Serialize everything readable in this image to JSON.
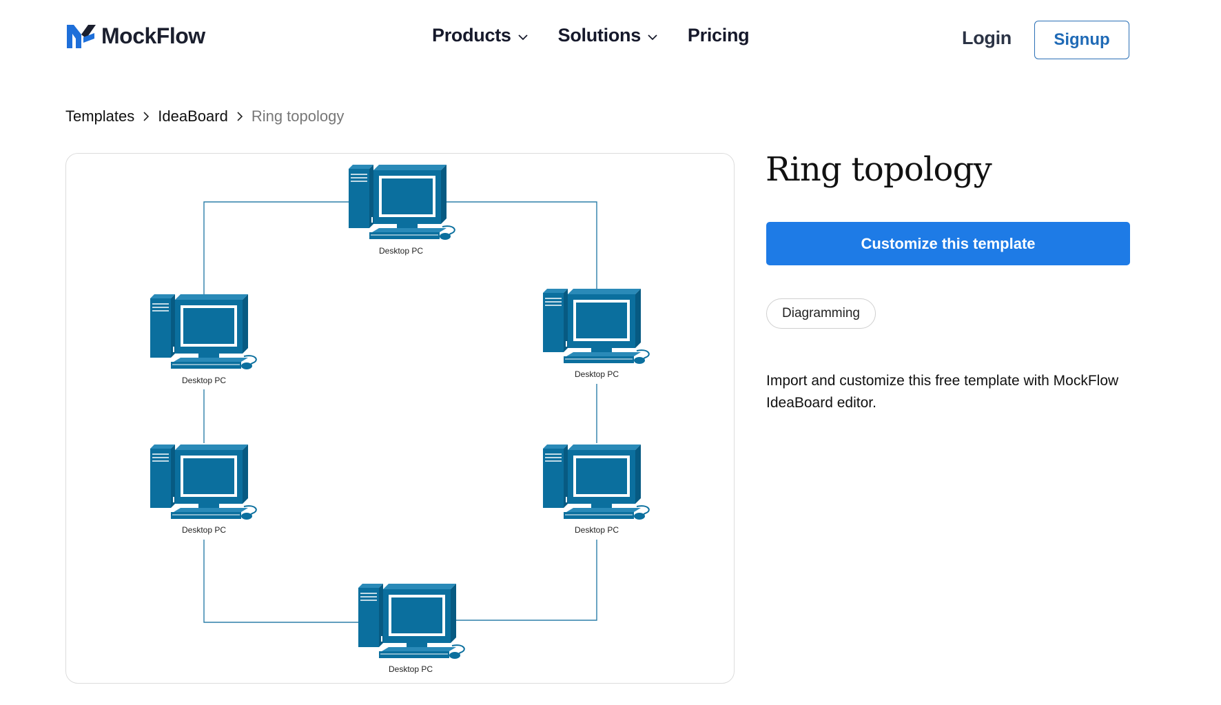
{
  "header": {
    "logo_text": "MockFlow",
    "nav": [
      {
        "label": "Products",
        "has_dropdown": true
      },
      {
        "label": "Solutions",
        "has_dropdown": true
      },
      {
        "label": "Pricing",
        "has_dropdown": false
      }
    ],
    "login_label": "Login",
    "signup_label": "Signup"
  },
  "breadcrumb": {
    "items": [
      "Templates",
      "IdeaBoard",
      "Ring topology"
    ]
  },
  "template": {
    "title": "Ring topology",
    "cta_label": "Customize this template",
    "tag": "Diagramming",
    "description": "Import and customize this free template with MockFlow IdeaBoard editor."
  },
  "diagram": {
    "node_label": "Desktop PC",
    "node_color": "#0b6f9e",
    "line_color": "#2b7ea8"
  },
  "colors": {
    "primary": "#1e7be6",
    "signup_border": "#2a6fb5",
    "text_dark": "#16192b"
  }
}
